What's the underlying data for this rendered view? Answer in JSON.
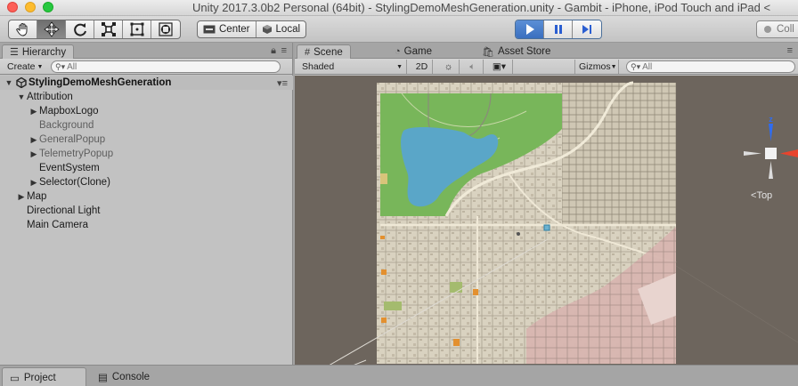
{
  "window": {
    "title": "Unity 2017.3.0b2 Personal (64bit) - StylingDemoMeshGeneration.unity - Gambit - iPhone, iPod Touch and iPad <"
  },
  "toolbar": {
    "transform_tools": [
      "hand-tool",
      "move-tool",
      "rotate-tool",
      "scale-tool",
      "rect-tool",
      "transform-tool"
    ],
    "active_tool": "move-tool",
    "pivot_label": "Center",
    "space_label": "Local",
    "collab_label": "Coll"
  },
  "hierarchy": {
    "tab_label": "Hierarchy",
    "create_label": "Create",
    "search_placeholder": "All",
    "scene_name": "StylingDemoMeshGeneration",
    "items": [
      {
        "label": "Attribution",
        "depth": 1,
        "fold": "expanded",
        "dim": false
      },
      {
        "label": "MapboxLogo",
        "depth": 2,
        "fold": "collapsed",
        "dim": false
      },
      {
        "label": "Background",
        "depth": 2,
        "fold": "none",
        "dim": true
      },
      {
        "label": "GeneralPopup",
        "depth": 2,
        "fold": "collapsed",
        "dim": true
      },
      {
        "label": "TelemetryPopup",
        "depth": 2,
        "fold": "collapsed",
        "dim": true
      },
      {
        "label": "EventSystem",
        "depth": 2,
        "fold": "none",
        "dim": false
      },
      {
        "label": "Selector(Clone)",
        "depth": 2,
        "fold": "collapsed",
        "dim": false
      },
      {
        "label": "Map",
        "depth": 1,
        "fold": "collapsed",
        "dim": false
      },
      {
        "label": "Directional Light",
        "depth": 1,
        "fold": "none",
        "dim": false
      },
      {
        "label": "Main Camera",
        "depth": 1,
        "fold": "none",
        "dim": false
      }
    ]
  },
  "scene_view": {
    "tabs": [
      {
        "label": "Scene",
        "active": true
      },
      {
        "label": "Game",
        "active": false
      },
      {
        "label": "Asset Store",
        "active": false
      }
    ],
    "shading_mode": "Shaded",
    "mode_2d_label": "2D",
    "gizmos_label": "Gizmos",
    "search_placeholder": "All",
    "orientation_label": "Top",
    "colors": {
      "background": "#6d655d",
      "park": "#78b65a",
      "water": "#5aa6c8",
      "urban": "#d9d2c0",
      "residential_pink": "#d8b6b0"
    }
  },
  "bottom_tabs": [
    {
      "label": "Project",
      "active": true
    },
    {
      "label": "Console",
      "active": false
    }
  ]
}
